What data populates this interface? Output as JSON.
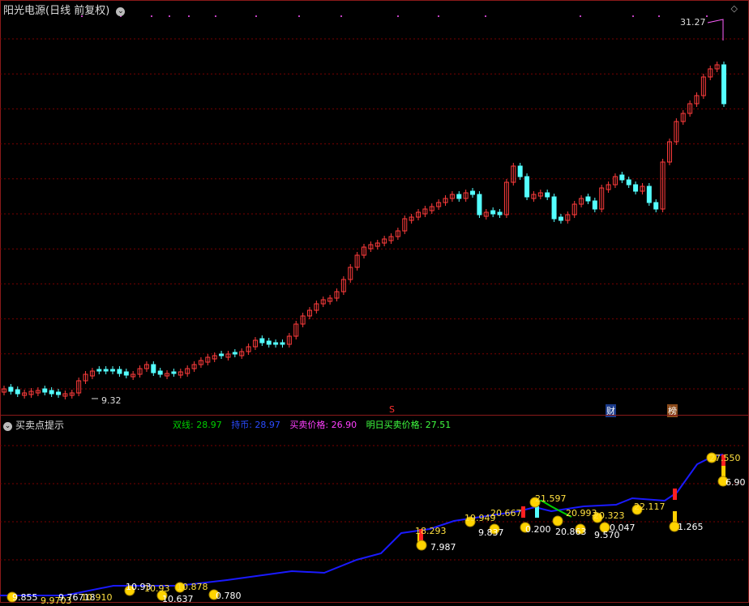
{
  "header": {
    "title": "阳光电源(日线 前复权)",
    "high_label": "31.27",
    "low_label": "9.32"
  },
  "indicator": {
    "title": "买卖点提示",
    "legend": [
      {
        "label": "双线: 28.97",
        "color": "#00d000"
      },
      {
        "label": "持币: 28.97",
        "color": "#2a4bff"
      },
      {
        "label": "买卖价格: 26.90",
        "color": "#ff40ff"
      },
      {
        "label": "明日买卖价格: 27.51",
        "color": "#40ff40"
      }
    ]
  },
  "markers": {
    "s_marker": "S",
    "cai_marker": "财",
    "bang_marker": "榜"
  },
  "price_labels": [
    "9.855",
    "9.9703",
    "9.76718",
    "10.910",
    "10.93",
    "10.93",
    "10.637",
    "10.878",
    "0.780",
    "18.293",
    "7.987",
    "19.949",
    "9.837",
    "20.667",
    "0.200",
    "21.597",
    "20.863",
    "20.993",
    "9.570",
    "20.323",
    "0.047",
    "22.117",
    "1.265",
    "27.550",
    "6.90"
  ],
  "colors": {
    "up": "#ff3c3c",
    "down": "#54ffff",
    "line": "#1a1aff",
    "grid": "#7a0000"
  }
}
